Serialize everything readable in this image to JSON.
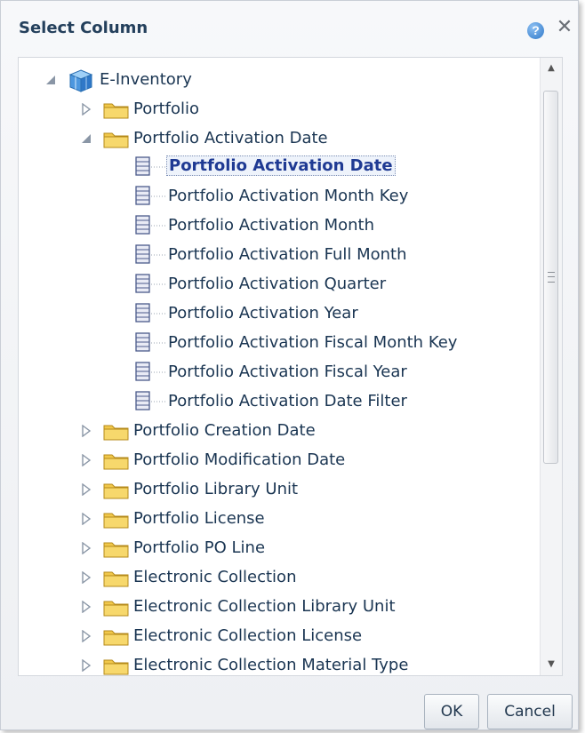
{
  "dialog": {
    "title": "Select Column",
    "help_icon_glyph": "?",
    "close_icon_glyph": "✕"
  },
  "tree": {
    "root": {
      "label": "E-Inventory",
      "icon": "cube-icon",
      "expanded": true
    },
    "folders_before": [
      {
        "label": "Portfolio",
        "expanded": false
      }
    ],
    "expanded_folder": {
      "label": "Portfolio Activation Date",
      "expanded": true,
      "columns": [
        {
          "label": "Portfolio Activation Date",
          "selected": true
        },
        {
          "label": "Portfolio Activation Month Key",
          "selected": false
        },
        {
          "label": "Portfolio Activation Month",
          "selected": false
        },
        {
          "label": "Portfolio Activation Full Month",
          "selected": false
        },
        {
          "label": "Portfolio Activation Quarter",
          "selected": false
        },
        {
          "label": "Portfolio Activation Year",
          "selected": false
        },
        {
          "label": "Portfolio Activation Fiscal Month Key",
          "selected": false
        },
        {
          "label": "Portfolio Activation Fiscal Year",
          "selected": false
        },
        {
          "label": "Portfolio Activation Date Filter",
          "selected": false
        }
      ]
    },
    "folders_after": [
      {
        "label": "Portfolio Creation Date",
        "expanded": false
      },
      {
        "label": "Portfolio Modification Date",
        "expanded": false
      },
      {
        "label": "Portfolio Library Unit",
        "expanded": false
      },
      {
        "label": "Portfolio License",
        "expanded": false
      },
      {
        "label": "Portfolio PO Line",
        "expanded": false
      },
      {
        "label": "Electronic Collection",
        "expanded": false
      },
      {
        "label": "Electronic Collection Library Unit",
        "expanded": false
      },
      {
        "label": "Electronic Collection License",
        "expanded": false
      },
      {
        "label": "Electronic Collection Material Type",
        "expanded": false
      }
    ]
  },
  "scrollbar": {
    "grip_glyph": "≡"
  },
  "buttons": {
    "ok_label": "OK",
    "cancel_label": "Cancel"
  },
  "colors": {
    "title": "#24405c",
    "text": "#1a3552",
    "selected_text": "#1f3a93",
    "folder": "#f1c84b"
  }
}
